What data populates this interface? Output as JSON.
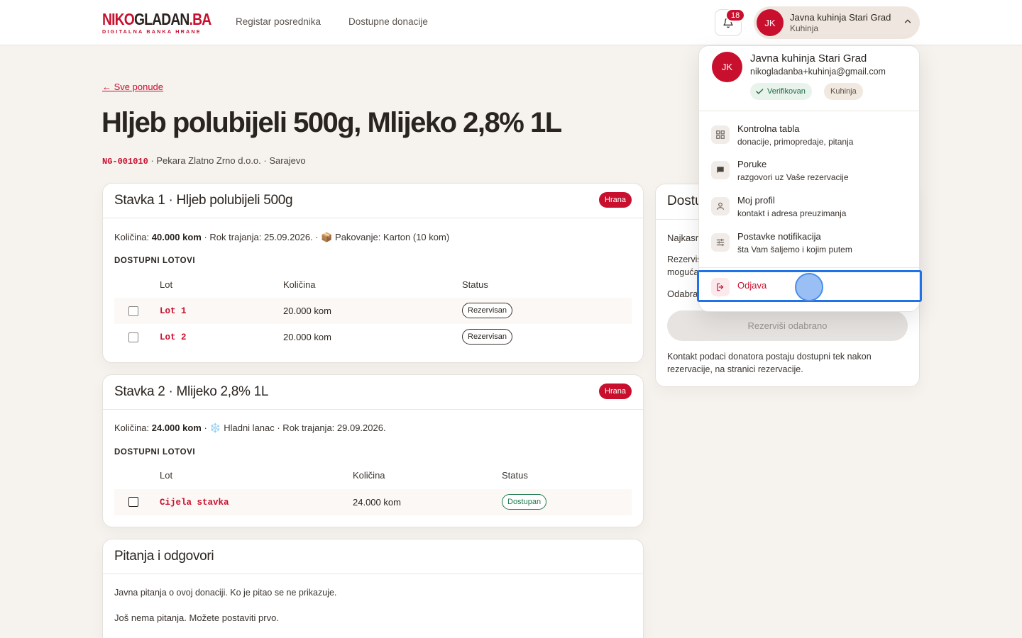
{
  "header": {
    "logo_main_red": "NIKO",
    "logo_main_dark": "GLADAN",
    "logo_main_suffix": ".BA",
    "logo_sub": "DIGITALNA BANKA HRANE",
    "nav": [
      "Registar posrednika",
      "Dostupne donacije"
    ],
    "notification_count": "18",
    "user": {
      "initials": "JK",
      "name": "Javna kuhinja Stari Grad",
      "role": "Kuhinja"
    }
  },
  "page": {
    "back_link": "← Sve ponude",
    "title": "Hljeb polubijeli 500g, Mlijeko 2,8% 1L",
    "code": "NG-001010",
    "meta_rest": " · Pekara Zlatno Zrno d.o.o. · Sarajevo"
  },
  "items": [
    {
      "title": "Stavka 1 · Hljeb polubijeli 500g",
      "tag": "Hrana",
      "details_prefix": "Količina: ",
      "details_qty": "40.000 kom",
      "details_rest": " · Rok trajanja: 25.09.2026. · 📦 Pakovanje: Karton (10 kom)",
      "lots_label": "DOSTUPNI LOTOVI",
      "columns": [
        "Lot",
        "Količina",
        "Status"
      ],
      "lots": [
        {
          "lot": "Lot 1",
          "qty": "20.000 kom",
          "status": "Rezervisan"
        },
        {
          "lot": "Lot 2",
          "qty": "20.000 kom",
          "status": "Rezervisan"
        }
      ]
    },
    {
      "title": "Stavka 2 · Mlijeko 2,8% 1L",
      "tag": "Hrana",
      "details_prefix": "Količina: ",
      "details_qty": "24.000 kom",
      "details_rest": " · ❄️ Hladni lanac · Rok trajanja: 29.09.2026.",
      "lots_label": "DOSTUPNI LOTOVI",
      "columns": [
        "Lot",
        "Količina",
        "Status"
      ],
      "lots": [
        {
          "lot": "Cijela stavka",
          "qty": "24.000 kom",
          "status": "Dostupan"
        }
      ]
    }
  ],
  "qa": {
    "title": "Pitanja i odgovori",
    "intro": "Javna pitanja o ovoj donaciji. Ko je pitao se ne prikazuje.",
    "empty": "Još nema pitanja. Možete postaviti prvo."
  },
  "side": {
    "title": "Dostu",
    "line1": "Najkasr",
    "line2a": "Rezervis",
    "line2b": "moguća",
    "line3": "Odabra",
    "button": "Rezerviši odabrano",
    "note": "Kontakt podaci donatora postaju dostupni tek nakon rezervacije, na stranici rezervacije."
  },
  "menu": {
    "initials": "JK",
    "name": "Javna kuhinja Stari Grad",
    "email": "nikogladanba+kuhinja@gmail.com",
    "verified": "Verifikovan",
    "role": "Kuhinja",
    "items": [
      {
        "label": "Kontrolna tabla",
        "desc": "donacije, primopredaje, pitanja",
        "icon": "dashboard-icon"
      },
      {
        "label": "Poruke",
        "desc": "razgovori uz Vaše rezervacije",
        "icon": "chat-icon"
      },
      {
        "label": "Moj profil",
        "desc": "kontakt i adresa preuzimanja",
        "icon": "person-icon"
      },
      {
        "label": "Postavke notifikacija",
        "desc": "šta Vam šaljemo i kojim putem",
        "icon": "tune-icon"
      }
    ],
    "logout": "Odjava"
  },
  "colors": {
    "brand": "#c8102e",
    "background": "#f6f2ee",
    "focus": "#1f73e6"
  }
}
